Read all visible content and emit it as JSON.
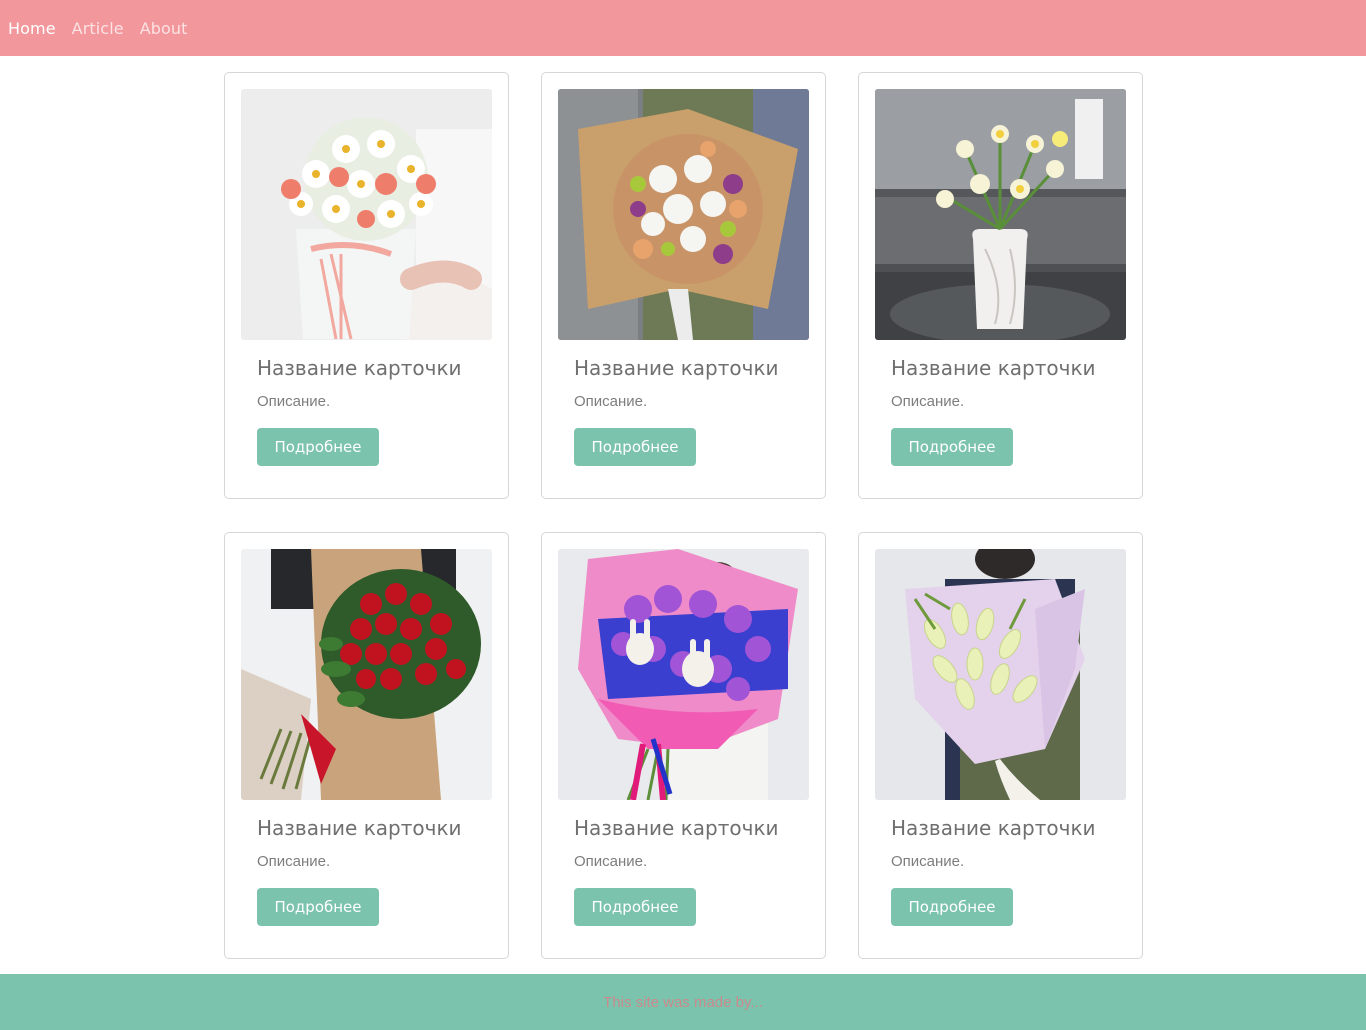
{
  "navbar": {
    "links": [
      {
        "label": "Home",
        "active": true
      },
      {
        "label": "Article",
        "active": false
      },
      {
        "label": "About",
        "active": false
      }
    ]
  },
  "cards": [
    {
      "title": "Название карточки",
      "description": "Описание.",
      "button": "Подробнее",
      "image": "white-daisy-and-coral-rose-hatbox-bouquet"
    },
    {
      "title": "Название карточки",
      "description": "Описание.",
      "button": "Подробнее",
      "image": "mixed-bouquet-in-kraft-paper"
    },
    {
      "title": "Название карточки",
      "description": "Описание.",
      "button": "Подробнее",
      "image": "daffodils-in-white-vase"
    },
    {
      "title": "Название карточки",
      "description": "Описание.",
      "button": "Подробнее",
      "image": "red-roses-bouquet"
    },
    {
      "title": "Название карточки",
      "description": "Описание.",
      "button": "Подробнее",
      "image": "purple-pink-bouquet-with-bunnies"
    },
    {
      "title": "Название карточки",
      "description": "Описание.",
      "button": "Подробнее",
      "image": "white-lilies-bouquet"
    }
  ],
  "footer": {
    "text": "This site was made by..."
  },
  "colors": {
    "navbar": "#f2979c",
    "footer": "#7cc3ad",
    "button": "#7cc3ad"
  }
}
